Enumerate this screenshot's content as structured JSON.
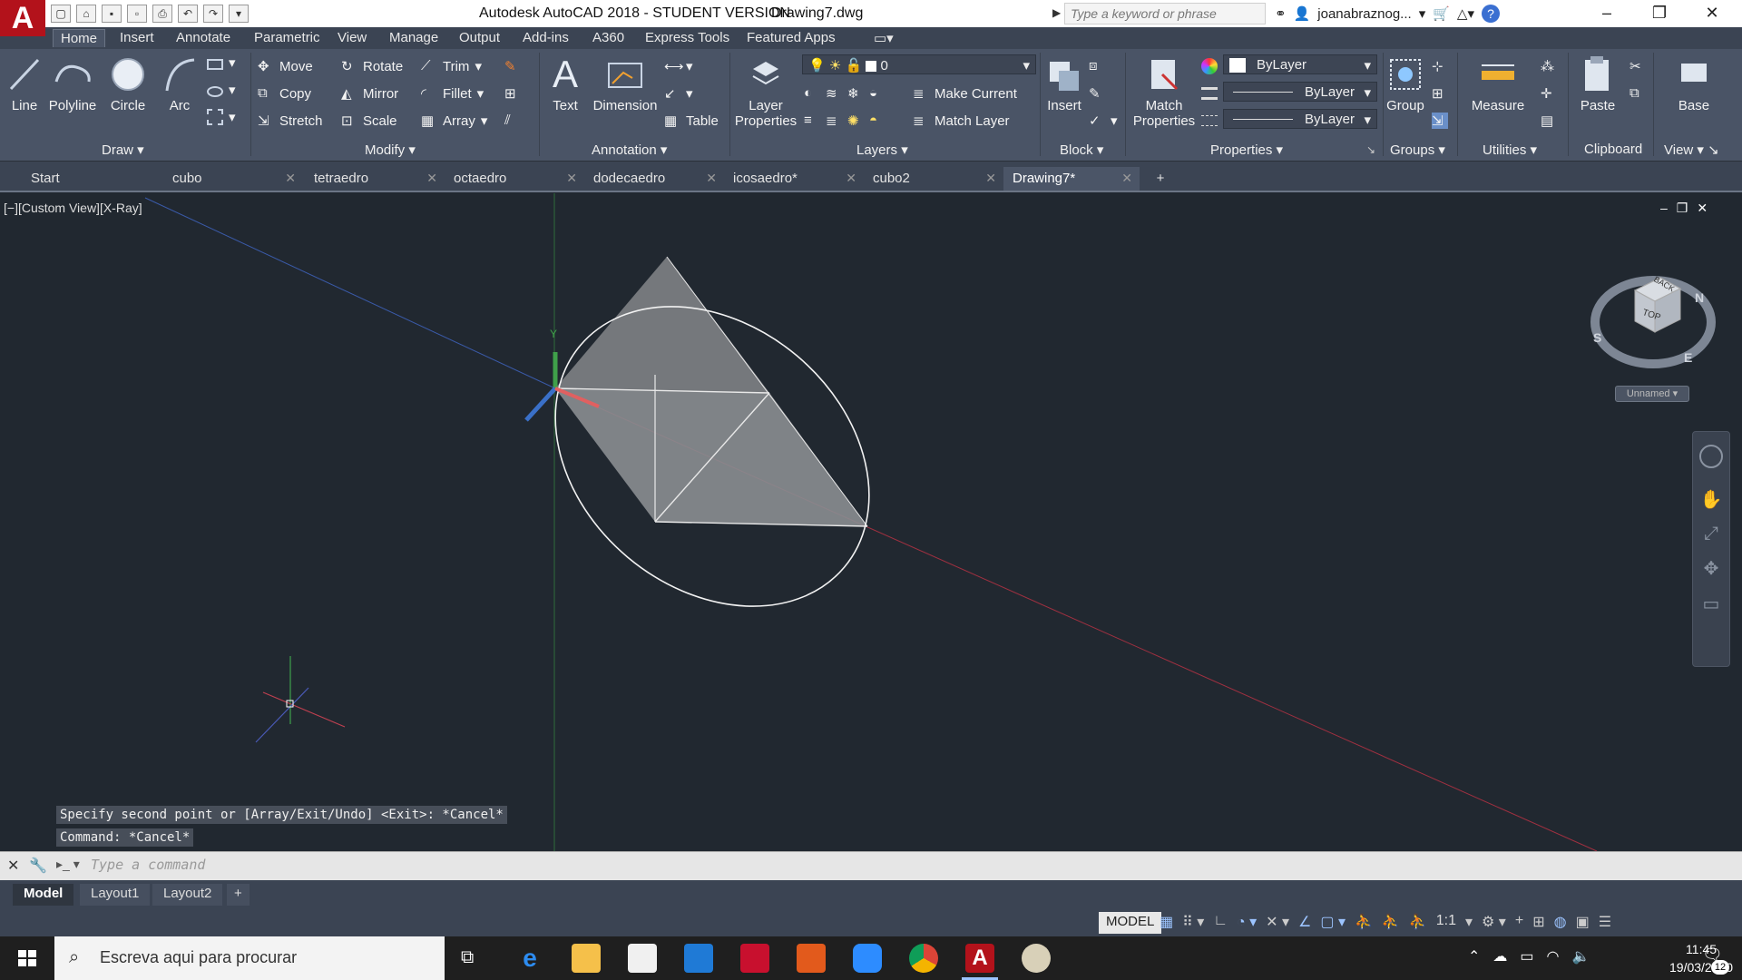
{
  "titlebar": {
    "app_logo": "A",
    "title": "Autodesk AutoCAD 2018 - STUDENT VERSION",
    "filename": "Drawing7.dwg",
    "search_placeholder": "Type a keyword or phrase",
    "user": "joanabraznog...",
    "help": "?"
  },
  "ribbon_tabs": [
    "Home",
    "Insert",
    "Annotate",
    "Parametric",
    "View",
    "Manage",
    "Output",
    "Add-ins",
    "A360",
    "Express Tools",
    "Featured Apps"
  ],
  "ribbon": {
    "draw": {
      "title": "Draw",
      "line": "Line",
      "polyline": "Polyline",
      "circle": "Circle",
      "arc": "Arc"
    },
    "modify": {
      "title": "Modify",
      "move": "Move",
      "rotate": "Rotate",
      "trim": "Trim",
      "copy": "Copy",
      "mirror": "Mirror",
      "fillet": "Fillet",
      "stretch": "Stretch",
      "scale": "Scale",
      "array": "Array"
    },
    "annotation": {
      "title": "Annotation",
      "text": "Text",
      "dimension": "Dimension",
      "table": "Table"
    },
    "layers": {
      "title": "Layers",
      "layer_properties_1": "Layer",
      "layer_properties_2": "Properties",
      "layer_value": "0",
      "make_current": "Make Current",
      "match_layer": "Match Layer"
    },
    "block": {
      "title": "Block",
      "insert": "Insert"
    },
    "properties": {
      "title": "Properties",
      "match_1": "Match",
      "match_2": "Properties",
      "color": "ByLayer",
      "linetype": "ByLayer",
      "lineweight": "ByLayer"
    },
    "groups": {
      "title": "Groups",
      "group": "Group"
    },
    "utilities": {
      "title": "Utilities",
      "measure": "Measure"
    },
    "clipboard": {
      "title": "Clipboard",
      "paste": "Paste"
    },
    "view": {
      "title": "View",
      "base": "Base"
    }
  },
  "doc_tabs": [
    "Start",
    "cubo",
    "tetraedro",
    "octaedro",
    "dodecaedro",
    "icosaedro*",
    "cubo2",
    "Drawing7*"
  ],
  "viewport": {
    "label": "[−][Custom View][X-Ray]",
    "viewcube_top": "TOP",
    "viewcube_back": "BACK",
    "compass_n": "N",
    "compass_s": "S",
    "compass_e": "E",
    "ucs_name": "Unnamed",
    "ucs_y": "Y"
  },
  "command": {
    "history": [
      "Specify second point or [Array/Exit/Undo] <Exit>: *Cancel*",
      "Command: *Cancel*"
    ],
    "placeholder": "Type a command"
  },
  "layout_tabs": [
    "Model",
    "Layout1",
    "Layout2"
  ],
  "status": {
    "model": "MODEL",
    "scale": "1:1"
  },
  "taskbar": {
    "search": "Escreva aqui para procurar",
    "time": "11:45",
    "date": "19/03/2020",
    "notif_count": "12"
  },
  "colors": {
    "accent": "#b3121b",
    "canvas": "#212830",
    "ribbon": "#4a5466"
  }
}
